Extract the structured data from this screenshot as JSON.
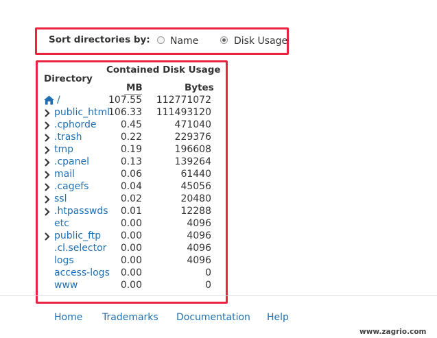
{
  "sort": {
    "label": "Sort directories by:",
    "options": [
      {
        "label": "Name",
        "selected": false
      },
      {
        "label": "Disk Usage",
        "selected": true
      }
    ]
  },
  "table": {
    "col_directory": "Directory",
    "group_header": "Contained Disk Usage",
    "col_mb": "MB",
    "col_bytes": "Bytes",
    "rows": [
      {
        "name": "/",
        "mb": "107.55",
        "bytes": "112771072",
        "expandable": false,
        "home": true
      },
      {
        "name": "public_html",
        "mb": "106.33",
        "bytes": "111493120",
        "expandable": true
      },
      {
        "name": ".cphorde",
        "mb": "0.45",
        "bytes": "471040",
        "expandable": true
      },
      {
        "name": ".trash",
        "mb": "0.22",
        "bytes": "229376",
        "expandable": true
      },
      {
        "name": "tmp",
        "mb": "0.19",
        "bytes": "196608",
        "expandable": true
      },
      {
        "name": ".cpanel",
        "mb": "0.13",
        "bytes": "139264",
        "expandable": true
      },
      {
        "name": "mail",
        "mb": "0.06",
        "bytes": "61440",
        "expandable": true
      },
      {
        "name": ".cagefs",
        "mb": "0.04",
        "bytes": "45056",
        "expandable": true
      },
      {
        "name": "ssl",
        "mb": "0.02",
        "bytes": "20480",
        "expandable": true
      },
      {
        "name": ".htpasswds",
        "mb": "0.01",
        "bytes": "12288",
        "expandable": true
      },
      {
        "name": "etc",
        "mb": "0.00",
        "bytes": "4096",
        "expandable": false
      },
      {
        "name": "public_ftp",
        "mb": "0.00",
        "bytes": "4096",
        "expandable": true
      },
      {
        "name": ".cl.selector",
        "mb": "0.00",
        "bytes": "4096",
        "expandable": false
      },
      {
        "name": "logs",
        "mb": "0.00",
        "bytes": "4096",
        "expandable": false
      },
      {
        "name": "access-logs",
        "mb": "0.00",
        "bytes": "0",
        "expandable": false
      },
      {
        "name": "www",
        "mb": "0.00",
        "bytes": "0",
        "expandable": false
      }
    ]
  },
  "footer": {
    "links": [
      "Home",
      "Trademarks",
      "Documentation",
      "Help"
    ]
  },
  "watermark": "www.zagrio.com",
  "colors": {
    "highlight": "#e8233f",
    "link": "#1f6fb2",
    "text": "#333333"
  }
}
